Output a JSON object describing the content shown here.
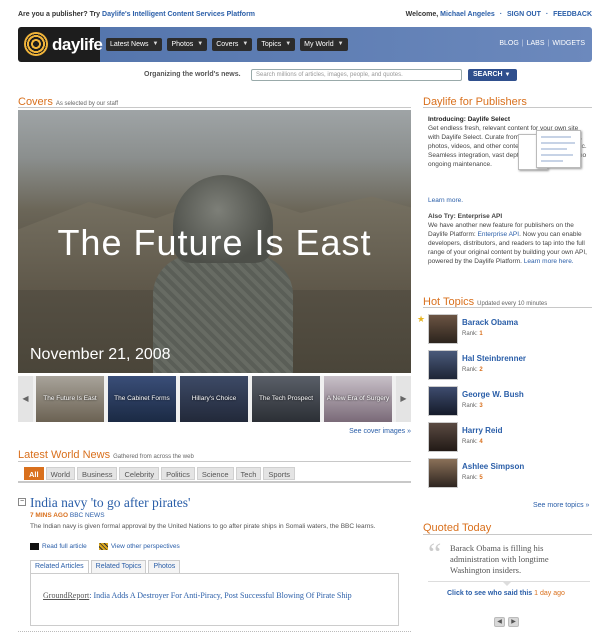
{
  "topbar": {
    "publisher_prompt": "Are you a publisher? Try",
    "publisher_link": "Daylife's Intelligent Content Services Platform",
    "welcome": "Welcome,",
    "user": "Michael Angeles",
    "signout": "SIGN OUT",
    "feedback": "FEEDBACK"
  },
  "header": {
    "logo": "daylife",
    "nav": [
      "Latest News",
      "Photos",
      "Covers",
      "Topics",
      "My World"
    ],
    "links": [
      "BLOG",
      "LABS",
      "WIDGETS"
    ]
  },
  "search": {
    "tagline": "Organizing the world's news.",
    "placeholder": "Search millions of articles, images, people, and quotes.",
    "button": "SEARCH"
  },
  "covers": {
    "heading": "Covers",
    "sub": "As selected by our staff",
    "title": "The Future Is East",
    "date": "November 21, 2008",
    "thumbs": [
      "The Future Is East",
      "The Cabinet Forms",
      "Hillary's Choice",
      "The Tech Prospect",
      "A New Era of Surgery"
    ],
    "see_more": "See cover images »"
  },
  "world_news": {
    "heading": "Latest World News",
    "sub": "Gathered from across the web",
    "filters": [
      "All",
      "World",
      "Business",
      "Celebrity",
      "Politics",
      "Science",
      "Tech",
      "Sports"
    ],
    "story": {
      "collapse": "−",
      "title": "India navy 'to go after pirates'",
      "ago": "7 MINS AGO",
      "source": "BBC NEWS",
      "summary": "The Indian navy is given formal approval by the United Nations to go after pirate ships in Somali waters, the BBC learns.",
      "read_full": "Read full article",
      "perspectives": "View other perspectives"
    },
    "related_tabs": [
      "Related Articles",
      "Related Topics",
      "Photos"
    ],
    "related_source": "GroundReport",
    "related_title": "India Adds A Destroyer For Anti-Piracy, Post Successful Blowing Of Pirate Ship"
  },
  "publishers": {
    "heading": "Daylife for Publishers",
    "intro_title": "Introducing: Daylife Select",
    "intro_body": "Get endless fresh, relevant content for your own site with Daylife Select. Curate from the Web's best news, photos, videos, and other content on virtually any topic. Seamless integration, vast depth and inventory, and no ongoing maintenance.",
    "learn_more": "Learn more.",
    "also_title": "Also Try: Enterprise API",
    "also_body_1": "We have another new feature for publishers on the Daylife Platform:",
    "also_link": "Enterprise API",
    "also_body_2": ". Now you can enable developers, distributors, and readers to tap into the full range of your original content by building your own API, powered by the Daylife Platform.",
    "learn_here": "Learn more here."
  },
  "hot_topics": {
    "heading": "Hot Topics",
    "sub": "Updated every 10 minutes",
    "rank_label": "Rank:",
    "items": [
      {
        "name": "Barack Obama",
        "rank": "1"
      },
      {
        "name": "Hal Steinbrenner",
        "rank": "2"
      },
      {
        "name": "George W. Bush",
        "rank": "3"
      },
      {
        "name": "Harry Reid",
        "rank": "4"
      },
      {
        "name": "Ashlee Simpson",
        "rank": "5"
      }
    ],
    "see_more": "See more topics »"
  },
  "quoted": {
    "heading": "Quoted Today",
    "quote": "Barack Obama is filling his administration with longtime Washington insiders.",
    "who_said": "Click to see who said this",
    "ago": "1 day ago"
  },
  "colors": {
    "accent": "#d9701d",
    "link": "#2a5ea8",
    "header": "#5576ad"
  }
}
